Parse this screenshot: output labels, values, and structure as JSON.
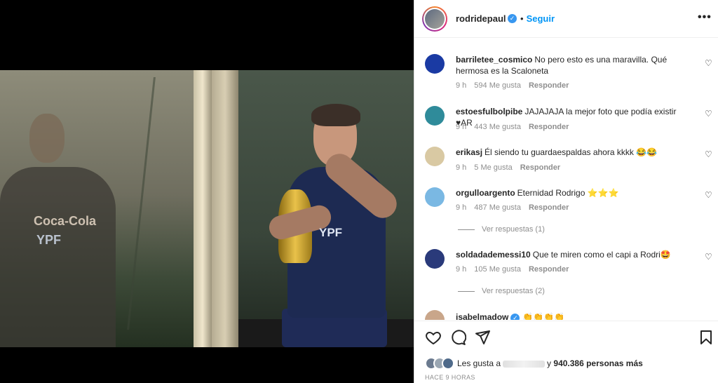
{
  "post": {
    "username": "rodridepaul",
    "follow_label": "Seguir",
    "separator": "•",
    "more_label": "•••",
    "photo_sponsor_text": "Coca-Cola",
    "photo_brand_text": "YPF",
    "photo_brand_text_2": "YPF"
  },
  "comments": [
    {
      "user": "barriletee_cosmico",
      "text": "No pero esto es una maravilla. Qué hermosa es la Scaloneta",
      "time": "9 h",
      "likes": "594 Me gusta",
      "reply": "Responder",
      "avatar_color": "#1a3aa3"
    },
    {
      "user": "estoesfulbolpibe",
      "text": "JAJAJAJA la mejor foto que podía existir ♥AR",
      "time": "9 h",
      "likes": "443 Me gusta",
      "reply": "Responder",
      "avatar_color": "#2f8b9a"
    },
    {
      "user": "erikasj",
      "text": "Él siendo tu guardaespaldas ahora kkkk 😂😂",
      "time": "9 h",
      "likes": "5 Me gusta",
      "reply": "Responder",
      "avatar_color": "#d9c9a3"
    },
    {
      "user": "orgulloargento",
      "text": "Eternidad Rodrigo ⭐⭐⭐",
      "time": "9 h",
      "likes": "487 Me gusta",
      "reply": "Responder",
      "avatar_color": "#7ab8e3",
      "view_replies": "Ver respuestas (1)"
    },
    {
      "user": "soldadademessi10",
      "text": "Que te miren como el capi a Rodri🤩",
      "time": "9 h",
      "likes": "105 Me gusta",
      "reply": "Responder",
      "avatar_color": "#2a3a7a",
      "view_replies": "Ver respuestas (2)"
    },
    {
      "user": "isabelmadow",
      "text": "👏👏👏👏",
      "avatar_color": "#c9a68a"
    }
  ],
  "likes_bar": {
    "prefix": "Les gusta a",
    "connector": "y",
    "count_text": "940.386 personas más",
    "time_ago": "HACE 9 HORAS"
  },
  "icons": [
    "heart-icon",
    "comment-icon",
    "share-icon",
    "bookmark-icon"
  ],
  "colors": {
    "accent": "#0095f6",
    "verified": "#3897f0",
    "text": "#262626",
    "muted": "#8e8e8e"
  }
}
